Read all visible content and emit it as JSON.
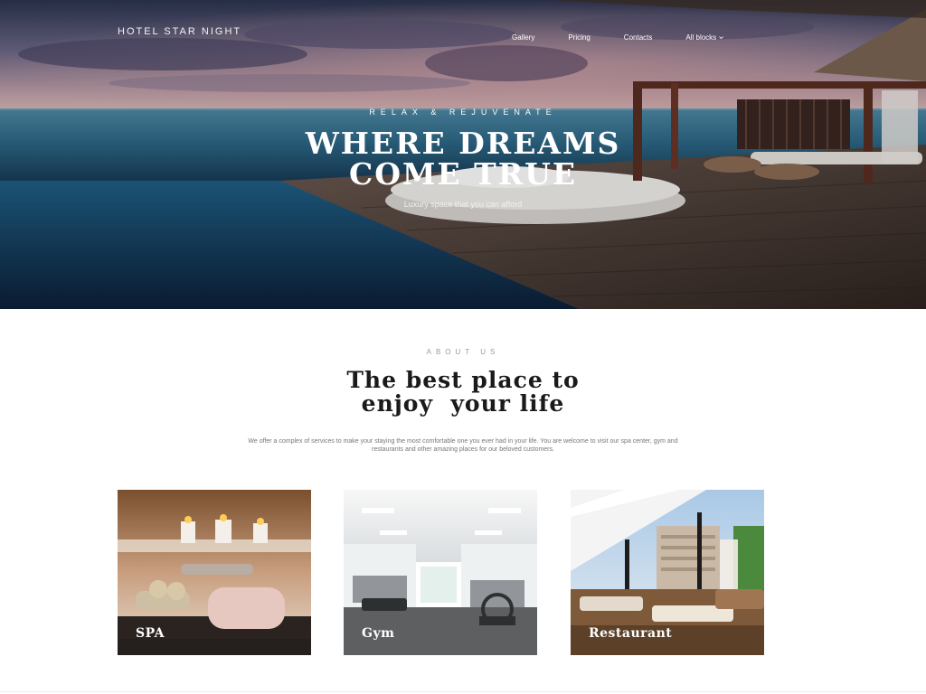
{
  "header": {
    "logo": "HOTEL STAR NIGHT",
    "nav": [
      {
        "label": "Gallery"
      },
      {
        "label": "Pricing"
      },
      {
        "label": "Contacts"
      },
      {
        "label": "All blocks",
        "icon": "chevron-down-icon"
      }
    ]
  },
  "hero": {
    "eyebrow": "RELAX & REJUVENATE",
    "title_line1": "WHERE DREAMS",
    "title_line2": "COME TRUE",
    "subtitle": "Luxury space that you can afford"
  },
  "about": {
    "eyebrow": "ABOUT US",
    "title_line1": "The best place to",
    "title_line2": "enjoy  your life",
    "text": "We offer a complex of services to make your staying the most comfortable one you ever had in your life. You are welcome to visit our spa center, gym and restaurants and other amazing places for our beloved customers."
  },
  "cards": [
    {
      "label": "SPA"
    },
    {
      "label": "Gym"
    },
    {
      "label": "Restaurant"
    }
  ],
  "colors": {
    "hero_sky_top": "#3a3f5e",
    "hero_sea": "#1e4f6f",
    "deck_wood": "#4a3a33",
    "text_dark": "#1a1a1a",
    "text_muted": "#777777"
  }
}
